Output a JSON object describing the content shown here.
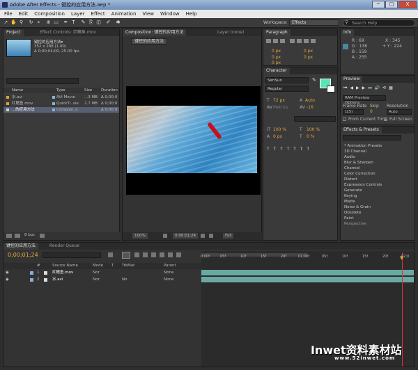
{
  "window": {
    "title": "Adobe After Effects - 键控的应用方法.aep *",
    "min": "─",
    "max": "□",
    "close": "X"
  },
  "menu": [
    "File",
    "Edit",
    "Composition",
    "Layer",
    "Effect",
    "Animation",
    "View",
    "Window",
    "Help"
  ],
  "workspace": {
    "label": "Workspace:",
    "value": "Effects",
    "search_placeholder": "Search Help"
  },
  "project": {
    "tabs": [
      "Project",
      "Effect Controls: 红鳍鱼.mov"
    ],
    "comp_name": "键控的应用方法▾",
    "info": [
      "352 x 288 (1.00)",
      "Δ 0;00;04;00, 25.00 fps"
    ],
    "columns": [
      "Name",
      "Type",
      "Size",
      "Duration"
    ],
    "items": [
      {
        "name": "水.avi",
        "type": "AVI Movie",
        "size": "...3 MB",
        "duration": "Δ 0;00;0"
      },
      {
        "name": "红鳍鱼.mov",
        "type": "QuickTi..vie",
        "size": "2.7 MB",
        "duration": "Δ 0;00;0"
      },
      {
        "name": "...的应用方法",
        "type": "Composi..n",
        "size": "",
        "duration": "Δ 0;00;0"
      }
    ],
    "bpc": "8 bpc"
  },
  "composition": {
    "tab": "Composition: 键控的应用方法",
    "sub": "键控的应用方法",
    "layer_tab": "Layer (none)",
    "zoom": "100%",
    "timecode": "0;00;01;24",
    "quality": "Full"
  },
  "paragraph": {
    "tab": "Paragraph",
    "vals": [
      "0 px",
      "0 px",
      "0 px",
      "0 px",
      "0 px"
    ]
  },
  "character": {
    "tab": "Character",
    "font": "SimSun",
    "style": "Regular",
    "size": "72 px",
    "leading": "Auto",
    "kerning": "Metrics",
    "tracking": "-16",
    "vscale": "100 %",
    "hscale": "100 %",
    "baseline": "0 px",
    "tsume": "0 %",
    "fill_color": "#5de2b4"
  },
  "info_panel": {
    "tab": "Info",
    "r": "R : 69",
    "g": "G : 138",
    "b": "B : 159",
    "a": "A : 255",
    "x": "X : 345",
    "y": "+ Y : 224",
    "swatch": "#45899f"
  },
  "preview": {
    "tab": "Preview",
    "ram": "RAM Preview Options",
    "frame_rate_label": "Frame Rate",
    "skip_label": "Skip",
    "resolution_label": "Resolution",
    "frame_rate": "(25)",
    "skip": "0",
    "resolution": "Auto",
    "from_current": "From Current Time",
    "full_screen": "Full Screen"
  },
  "effects": {
    "tab": "Effects & Presets",
    "items": [
      "* Animation Presets",
      "3D Channel",
      "Audio",
      "Blur & Sharpen",
      "Channel",
      "Color Correction",
      "Distort",
      "Expression Controls",
      "Generate",
      "Keying",
      "Matte",
      "Noise & Grain",
      "Obsolete",
      "Paint",
      "Perspective"
    ]
  },
  "timeline": {
    "tabs": [
      "键控的应用方法",
      "Render Queue"
    ],
    "timecode": "0;00;01;24",
    "columns": [
      "#",
      "Source Name",
      "Mode",
      "T",
      "TrkMat",
      "Parent"
    ],
    "layers": [
      {
        "num": "1",
        "name": "红鳍鱼.mov",
        "mode": "Nor",
        "trkmat": "",
        "parent": "None"
      },
      {
        "num": "2",
        "name": "水.avi",
        "mode": "Nor",
        "trkmat": "No",
        "parent": "None"
      }
    ],
    "ticks": [
      "0;00f",
      "05f",
      "10f",
      "15f",
      "20f",
      "01;00f",
      "05f",
      "10f",
      "15f",
      "20f",
      "02;0"
    ]
  },
  "watermark": {
    "brand": "Inwet资料素材站",
    "url": "www.52inwet.com"
  },
  "colors": {
    "accent": "#e5a540",
    "layer_bar": "#6aa9a3",
    "selection": "#586074"
  }
}
